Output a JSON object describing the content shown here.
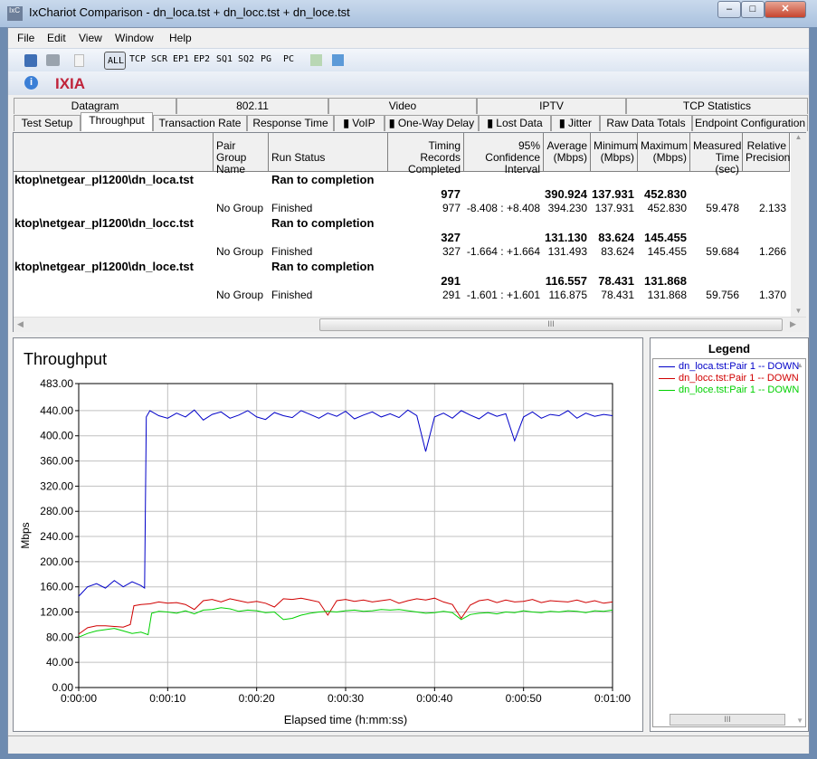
{
  "window": {
    "title": "IxChariot Comparison - dn_loca.tst + dn_locc.tst + dn_loce.tst",
    "app_icon": "IxC",
    "minimize": "‒",
    "maximize": "□",
    "close": "✕"
  },
  "menu": [
    "File",
    "Edit",
    "View",
    "Window",
    "Help"
  ],
  "toolbar": {
    "filters": [
      "ALL",
      "TCP",
      "SCR",
      "EP1",
      "EP2",
      "SQ1",
      "SQ2",
      "PG",
      "PC"
    ],
    "icons": [
      "save-icon",
      "print-icon",
      "copy-icon",
      "export-icon",
      "import-icon"
    ]
  },
  "brand": {
    "logo": "IXIA",
    "info_icon": "i"
  },
  "tabs_top": [
    "Datagram",
    "802.11",
    "Video",
    "IPTV",
    "TCP Statistics"
  ],
  "tabs_bottom": [
    "Test Setup",
    "Throughput",
    "Transaction Rate",
    "Response Time",
    "VoIP",
    "One-Way Delay",
    "Lost Data",
    "Jitter",
    "Raw Data Totals",
    "Endpoint Configuration"
  ],
  "active_tab": "Throughput",
  "table": {
    "headers": [
      "",
      "Pair Group Name",
      "Run Status",
      "Timing Records Completed",
      "95% Confidence Interval",
      "Average (Mbps)",
      "Minimum (Mbps)",
      "Maximum (Mbps)",
      "Measured Time (sec)",
      "Relative Precision"
    ],
    "groups": [
      {
        "file": "ktop\\netgear_pl1200\\dn_loca.tst",
        "status": "Ran to completion",
        "summary": [
          "977",
          "390.924",
          "137.931",
          "452.830"
        ],
        "pair": [
          "No Group",
          "Finished",
          "977",
          "-8.408 : +8.408",
          "394.230",
          "137.931",
          "452.830",
          "59.478",
          "2.133"
        ]
      },
      {
        "file": "ktop\\netgear_pl1200\\dn_locc.tst",
        "status": "Ran to completion",
        "summary": [
          "327",
          "131.130",
          "83.624",
          "145.455"
        ],
        "pair": [
          "No Group",
          "Finished",
          "327",
          "-1.664 : +1.664",
          "131.493",
          "83.624",
          "145.455",
          "59.684",
          "1.266"
        ]
      },
      {
        "file": "ktop\\netgear_pl1200\\dn_loce.tst",
        "status": "Ran to completion",
        "summary": [
          "291",
          "116.557",
          "78.431",
          "131.868"
        ],
        "pair": [
          "No Group",
          "Finished",
          "291",
          "-1.601 : +1.601",
          "116.875",
          "78.431",
          "131.868",
          "59.756",
          "1.370"
        ]
      }
    ],
    "hscroll_grip": "III"
  },
  "legend": {
    "title": "Legend"
  },
  "chart_data": {
    "type": "line",
    "title": "Throughput",
    "xlabel": "Elapsed time (h:mm:ss)",
    "ylabel": "Mbps",
    "xlim": [
      0,
      60
    ],
    "ylim": [
      0,
      483
    ],
    "grid": true,
    "yticks": [
      "0.00",
      "40.00",
      "80.00",
      "120.00",
      "160.00",
      "200.00",
      "240.00",
      "280.00",
      "320.00",
      "360.00",
      "400.00",
      "440.00",
      "483.00"
    ],
    "xticks": [
      "0:00:00",
      "0:00:10",
      "0:00:20",
      "0:00:30",
      "0:00:40",
      "0:00:50",
      "0:01:00"
    ],
    "series": [
      {
        "name": "dn_loca.tst:Pair 1 -- DOWN",
        "color": "#0000c8",
        "x": [
          0,
          1,
          2,
          3,
          4,
          5,
          6,
          7,
          7.4,
          7.6,
          8,
          9,
          10,
          11,
          12,
          13,
          14,
          15,
          16,
          17,
          18,
          19,
          20,
          21,
          22,
          23,
          24,
          25,
          26,
          27,
          28,
          29,
          30,
          31,
          32,
          33,
          34,
          35,
          36,
          37,
          38,
          39,
          40,
          41,
          42,
          43,
          44,
          45,
          46,
          47,
          48,
          49,
          50,
          51,
          52,
          53,
          54,
          55,
          56,
          57,
          58,
          59,
          60
        ],
        "y": [
          145,
          160,
          165,
          158,
          170,
          160,
          168,
          162,
          158,
          430,
          440,
          432,
          428,
          436,
          430,
          441,
          425,
          434,
          438,
          428,
          433,
          440,
          430,
          426,
          437,
          432,
          429,
          440,
          434,
          428,
          436,
          431,
          439,
          427,
          433,
          438,
          430,
          435,
          429,
          441,
          432,
          375,
          430,
          436,
          428,
          440,
          433,
          427,
          437,
          431,
          435,
          392,
          430,
          438,
          428,
          434,
          432,
          440,
          428,
          436,
          431,
          434,
          432
        ]
      },
      {
        "name": "dn_locc.tst:Pair 1 -- DOWN",
        "color": "#d00000",
        "x": [
          0,
          1,
          2,
          3,
          4,
          5,
          5.8,
          6.2,
          7,
          8,
          9,
          10,
          11,
          12,
          13,
          14,
          15,
          16,
          17,
          18,
          19,
          20,
          21,
          22,
          23,
          24,
          25,
          26,
          27,
          28,
          29,
          30,
          31,
          32,
          33,
          34,
          35,
          36,
          37,
          38,
          39,
          40,
          41,
          42,
          43,
          44,
          45,
          46,
          47,
          48,
          49,
          50,
          51,
          52,
          53,
          54,
          55,
          56,
          57,
          58,
          59,
          60
        ],
        "y": [
          85,
          95,
          98,
          98,
          97,
          96,
          100,
          130,
          132,
          133,
          136,
          134,
          135,
          132,
          124,
          138,
          140,
          136,
          141,
          138,
          135,
          137,
          134,
          128,
          141,
          140,
          142,
          139,
          136,
          115,
          138,
          140,
          137,
          139,
          136,
          138,
          140,
          134,
          138,
          141,
          139,
          142,
          136,
          132,
          110,
          131,
          138,
          140,
          135,
          139,
          136,
          137,
          140,
          135,
          138,
          137,
          136,
          139,
          135,
          138,
          134,
          136
        ]
      },
      {
        "name": "dn_loce.tst:Pair 1 -- DOWN",
        "color": "#00d000",
        "x": [
          0,
          1,
          2,
          3,
          4,
          5,
          6,
          7,
          7.8,
          8.2,
          9,
          10,
          11,
          12,
          13,
          14,
          15,
          16,
          17,
          18,
          19,
          20,
          21,
          22,
          23,
          24,
          25,
          26,
          27,
          28,
          29,
          30,
          31,
          32,
          33,
          34,
          35,
          36,
          37,
          38,
          39,
          40,
          41,
          42,
          43,
          44,
          45,
          46,
          47,
          48,
          49,
          50,
          51,
          52,
          53,
          54,
          55,
          56,
          57,
          58,
          59,
          60
        ],
        "y": [
          80,
          86,
          90,
          92,
          94,
          90,
          86,
          88,
          84,
          118,
          121,
          120,
          118,
          122,
          117,
          123,
          124,
          127,
          125,
          121,
          123,
          122,
          119,
          120,
          108,
          110,
          115,
          118,
          120,
          121,
          120,
          122,
          123,
          121,
          122,
          124,
          123,
          124,
          122,
          120,
          118,
          119,
          121,
          119,
          108,
          116,
          118,
          119,
          117,
          120,
          119,
          122,
          120,
          119,
          121,
          120,
          122,
          121,
          119,
          122,
          121,
          123
        ]
      }
    ]
  }
}
